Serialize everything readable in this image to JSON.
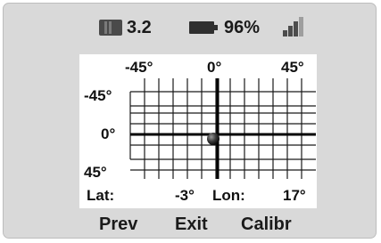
{
  "status_bar": {
    "storage_icon": "sd-card-icon",
    "storage_value": "3.2",
    "battery_icon": "battery-icon",
    "battery_value": "96%",
    "signal_icon": "signal-strength-icon",
    "signal_level_bars": 3,
    "signal_max_bars": 4
  },
  "grid": {
    "top_labels": [
      "-45°",
      "0°",
      "45°"
    ],
    "left_labels": [
      "-45°",
      "0°",
      "45°"
    ],
    "indicator": "position-dot"
  },
  "readout": {
    "lat_label": "Lat:",
    "lat_value": "-3°",
    "lon_label": "Lon:",
    "lon_value": "17°"
  },
  "softkeys": {
    "prev": "Prev",
    "exit": "Exit",
    "calibr": "Calibr"
  },
  "colors": {
    "screen_background": "#d9d9d9",
    "panel_background": "#ffffff",
    "grid_lines": "#1a1a1a",
    "text": "#1a1a1a"
  }
}
